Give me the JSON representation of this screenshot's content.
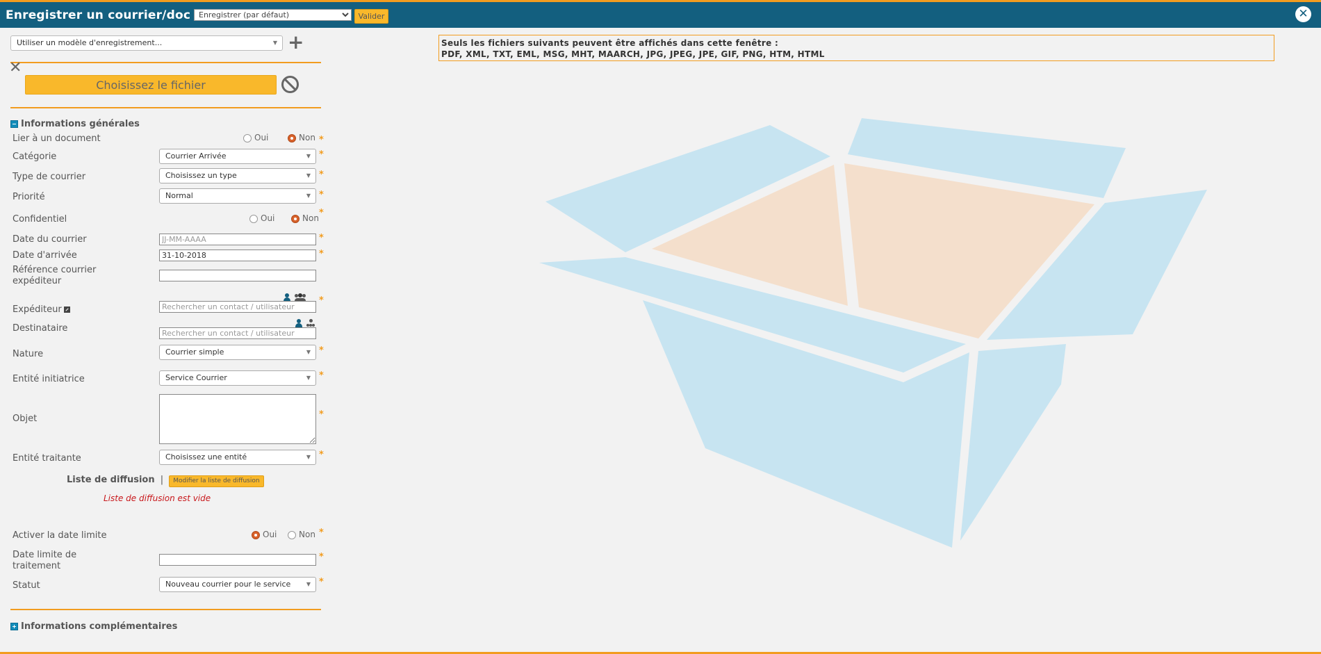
{
  "header": {
    "title": "Enregistrer un courrier/doc :",
    "mode_select": "Enregistrer (par défaut)",
    "validate_label": "Valider",
    "close_icon": "close-icon"
  },
  "toolbar": {
    "model_select": "Utiliser un modèle d'enregistrement...",
    "choose_file": "Choisissez le fichier"
  },
  "general": {
    "title": "Informations générales",
    "link_doc": {
      "label": "Lier à un document",
      "options": [
        "Oui",
        "Non"
      ],
      "selected": "Non"
    },
    "category": {
      "label": "Catégorie",
      "value": "Courrier Arrivée"
    },
    "mail_type": {
      "label": "Type de courrier",
      "value": "Choisissez un type"
    },
    "priority": {
      "label": "Priorité",
      "value": "Normal"
    },
    "confidential": {
      "label": "Confidentiel",
      "options": [
        "Oui",
        "Non"
      ],
      "selected": "Non"
    },
    "mail_date": {
      "label": "Date du courrier",
      "placeholder": "JJ-MM-AAAA"
    },
    "arrival_date": {
      "label": "Date d'arrivée",
      "value": "31-10-2018"
    },
    "sender_ref": {
      "label_line1": "Référence courrier",
      "label_line2": "expéditeur"
    },
    "sender": {
      "label": "Expéditeur",
      "placeholder": "Rechercher un contact / utilisateur"
    },
    "recipient": {
      "label": "Destinataire",
      "placeholder": "Rechercher un contact / utilisateur"
    },
    "nature": {
      "label": "Nature",
      "value": "Courrier simple"
    },
    "initiating_entity": {
      "label": "Entité initiatrice",
      "value": "Service Courrier"
    },
    "subject": {
      "label": "Objet"
    },
    "processing_entity": {
      "label": "Entité traitante",
      "value": "Choisissez une entité"
    },
    "diffusion": {
      "label": "Liste de diffusion",
      "separator": "|",
      "modify_label": "Modifier la liste de diffusion",
      "empty_message": "Liste de diffusion est vide"
    },
    "deadline_toggle": {
      "label": "Activer la date limite",
      "options": [
        "Oui",
        "Non"
      ],
      "selected": "Oui"
    },
    "deadline": {
      "label_line1": "Date limite de",
      "label_line2": "traitement"
    },
    "status": {
      "label": "Statut",
      "value": "Nouveau courrier pour le service"
    }
  },
  "more": {
    "title": "Informations complémentaires"
  },
  "preview": {
    "notice_line1": "Seuls les fichiers suivants peuvent être affichés dans cette fenêtre :",
    "notice_line2": "PDF, XML, TXT, EML, MSG, MHT, MAARCH, JPG, JPEG, JPE, GIF, PNG, HTM, HTML",
    "colors": {
      "box_blue": "#c7e4f1",
      "box_orange": "#f4dfcc"
    }
  },
  "colors": {
    "header": "#135f7f",
    "accent": "#f29c1f",
    "button": "#f9b82b",
    "error": "#c8171b"
  }
}
